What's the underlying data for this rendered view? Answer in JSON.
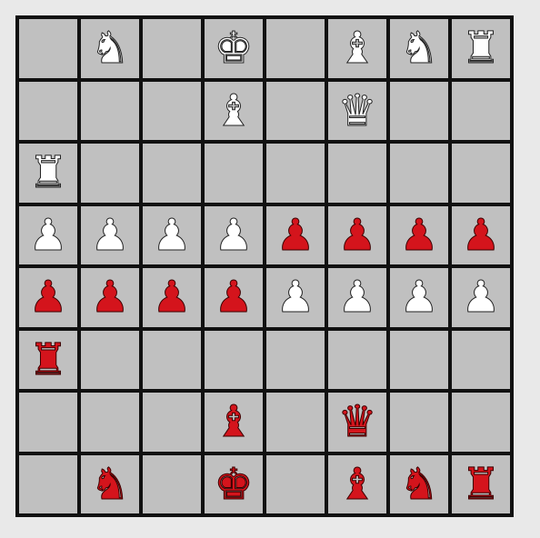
{
  "board": {
    "rows": 8,
    "cols": 8,
    "square_color": "#c0c0c0",
    "line_color": "#111111",
    "piece_colors": {
      "white": "#ffffff",
      "red": "#d4141c"
    }
  },
  "glyphs": {
    "K": "♚",
    "Q": "♛",
    "R": "♜",
    "B": "♝",
    "N": "♞",
    "P": "♟"
  },
  "pieces": [
    {
      "row": 0,
      "col": 1,
      "type": "N",
      "color": "white",
      "name": "knight"
    },
    {
      "row": 0,
      "col": 3,
      "type": "K",
      "color": "white",
      "name": "king"
    },
    {
      "row": 0,
      "col": 5,
      "type": "B",
      "color": "white",
      "name": "bishop"
    },
    {
      "row": 0,
      "col": 6,
      "type": "N",
      "color": "white",
      "name": "knight"
    },
    {
      "row": 0,
      "col": 7,
      "type": "R",
      "color": "white",
      "name": "rook"
    },
    {
      "row": 1,
      "col": 3,
      "type": "B",
      "color": "white",
      "name": "bishop"
    },
    {
      "row": 1,
      "col": 5,
      "type": "Q",
      "color": "white",
      "name": "queen"
    },
    {
      "row": 2,
      "col": 0,
      "type": "R",
      "color": "white",
      "name": "rook"
    },
    {
      "row": 3,
      "col": 0,
      "type": "P",
      "color": "white",
      "name": "pawn"
    },
    {
      "row": 3,
      "col": 1,
      "type": "P",
      "color": "white",
      "name": "pawn"
    },
    {
      "row": 3,
      "col": 2,
      "type": "P",
      "color": "white",
      "name": "pawn"
    },
    {
      "row": 3,
      "col": 3,
      "type": "P",
      "color": "white",
      "name": "pawn"
    },
    {
      "row": 3,
      "col": 4,
      "type": "P",
      "color": "red",
      "name": "pawn"
    },
    {
      "row": 3,
      "col": 5,
      "type": "P",
      "color": "red",
      "name": "pawn"
    },
    {
      "row": 3,
      "col": 6,
      "type": "P",
      "color": "red",
      "name": "pawn"
    },
    {
      "row": 3,
      "col": 7,
      "type": "P",
      "color": "red",
      "name": "pawn"
    },
    {
      "row": 4,
      "col": 0,
      "type": "P",
      "color": "red",
      "name": "pawn"
    },
    {
      "row": 4,
      "col": 1,
      "type": "P",
      "color": "red",
      "name": "pawn"
    },
    {
      "row": 4,
      "col": 2,
      "type": "P",
      "color": "red",
      "name": "pawn"
    },
    {
      "row": 4,
      "col": 3,
      "type": "P",
      "color": "red",
      "name": "pawn"
    },
    {
      "row": 4,
      "col": 4,
      "type": "P",
      "color": "white",
      "name": "pawn"
    },
    {
      "row": 4,
      "col": 5,
      "type": "P",
      "color": "white",
      "name": "pawn"
    },
    {
      "row": 4,
      "col": 6,
      "type": "P",
      "color": "white",
      "name": "pawn"
    },
    {
      "row": 4,
      "col": 7,
      "type": "P",
      "color": "white",
      "name": "pawn"
    },
    {
      "row": 5,
      "col": 0,
      "type": "R",
      "color": "red",
      "name": "rook"
    },
    {
      "row": 6,
      "col": 3,
      "type": "B",
      "color": "red",
      "name": "bishop"
    },
    {
      "row": 6,
      "col": 5,
      "type": "Q",
      "color": "red",
      "name": "queen"
    },
    {
      "row": 7,
      "col": 1,
      "type": "N",
      "color": "red",
      "name": "knight"
    },
    {
      "row": 7,
      "col": 3,
      "type": "K",
      "color": "red",
      "name": "king"
    },
    {
      "row": 7,
      "col": 5,
      "type": "B",
      "color": "red",
      "name": "bishop"
    },
    {
      "row": 7,
      "col": 6,
      "type": "N",
      "color": "red",
      "name": "knight"
    },
    {
      "row": 7,
      "col": 7,
      "type": "R",
      "color": "red",
      "name": "rook"
    }
  ]
}
